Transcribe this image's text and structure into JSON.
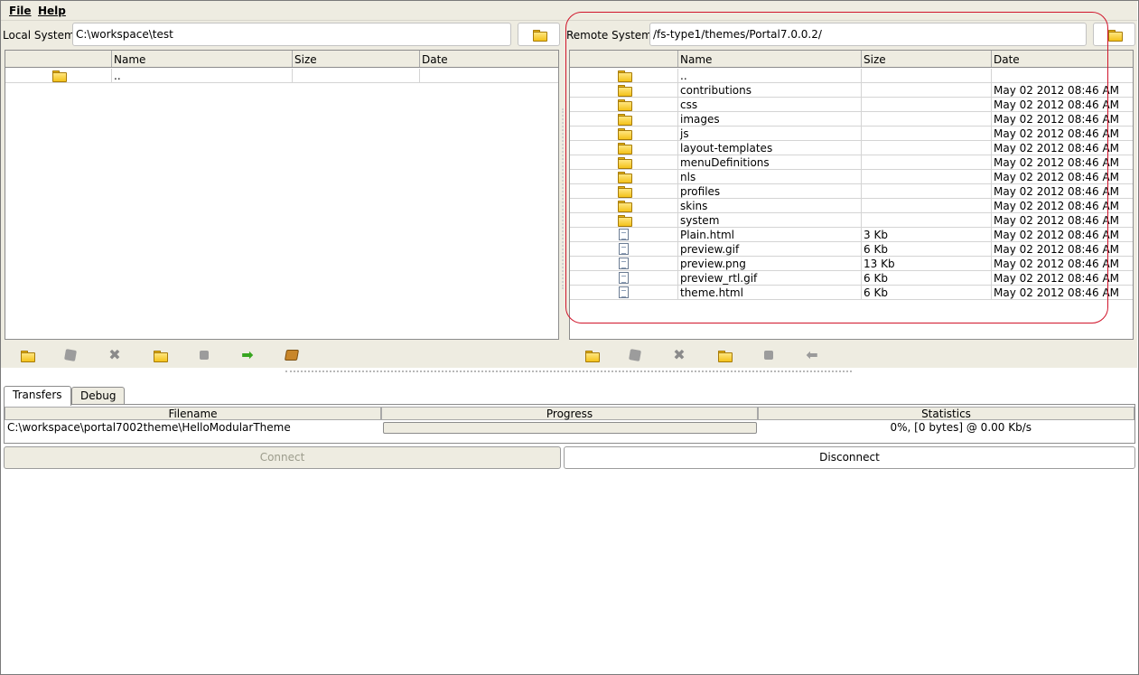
{
  "menu": {
    "file": "File",
    "help": "Help"
  },
  "local": {
    "label": "Local System",
    "path": "C:\\workspace\\test",
    "columns": [
      "",
      "Name",
      "Size",
      "Date"
    ],
    "rows": [
      {
        "icon": "folder-icon",
        "name": "..",
        "size": "",
        "date": ""
      }
    ]
  },
  "remote": {
    "label": "Remote System",
    "path": "/fs-type1/themes/Portal7.0.0.2/",
    "columns": [
      "",
      "Name",
      "Size",
      "Date"
    ],
    "rows": [
      {
        "icon": "folder-icon",
        "name": "..",
        "size": "",
        "date": ""
      },
      {
        "icon": "folder-icon",
        "name": "contributions",
        "size": "",
        "date": "May 02 2012 08:46 AM"
      },
      {
        "icon": "folder-icon",
        "name": "css",
        "size": "",
        "date": "May 02 2012 08:46 AM"
      },
      {
        "icon": "folder-icon",
        "name": "images",
        "size": "",
        "date": "May 02 2012 08:46 AM"
      },
      {
        "icon": "folder-icon",
        "name": "js",
        "size": "",
        "date": "May 02 2012 08:46 AM"
      },
      {
        "icon": "folder-icon",
        "name": "layout-templates",
        "size": "",
        "date": "May 02 2012 08:46 AM"
      },
      {
        "icon": "folder-icon",
        "name": "menuDefinitions",
        "size": "",
        "date": "May 02 2012 08:46 AM"
      },
      {
        "icon": "folder-icon",
        "name": "nls",
        "size": "",
        "date": "May 02 2012 08:46 AM"
      },
      {
        "icon": "folder-icon",
        "name": "profiles",
        "size": "",
        "date": "May 02 2012 08:46 AM"
      },
      {
        "icon": "folder-icon",
        "name": "skins",
        "size": "",
        "date": "May 02 2012 08:46 AM"
      },
      {
        "icon": "folder-icon",
        "name": "system",
        "size": "",
        "date": "May 02 2012 08:46 AM"
      },
      {
        "icon": "file-icon",
        "name": "Plain.html",
        "size": "3 Kb",
        "date": "May 02 2012 08:46 AM"
      },
      {
        "icon": "file-icon",
        "name": "preview.gif",
        "size": "6 Kb",
        "date": "May 02 2012 08:46 AM"
      },
      {
        "icon": "file-icon",
        "name": "preview.png",
        "size": "13 Kb",
        "date": "May 02 2012 08:46 AM"
      },
      {
        "icon": "file-icon",
        "name": "preview_rtl.gif",
        "size": "6 Kb",
        "date": "May 02 2012 08:46 AM"
      },
      {
        "icon": "file-icon",
        "name": "theme.html",
        "size": "6 Kb",
        "date": "May 02 2012 08:46 AM"
      }
    ]
  },
  "tabs": [
    "Transfers",
    "Debug"
  ],
  "transfers": {
    "columns": [
      "Filename",
      "Progress",
      "Statistics"
    ],
    "row": {
      "filename": "C:\\workspace\\portal7002theme\\HelloModularTheme",
      "progress": 0,
      "statistics": "0%, [0 bytes] @ 0.00 Kb/s"
    }
  },
  "buttons": {
    "connect": "Connect",
    "disconnect": "Disconnect"
  },
  "colors": {
    "highlight": "#d0142a",
    "panel_bg": "#eeece1",
    "transfer_arrow": "#37a51f"
  }
}
